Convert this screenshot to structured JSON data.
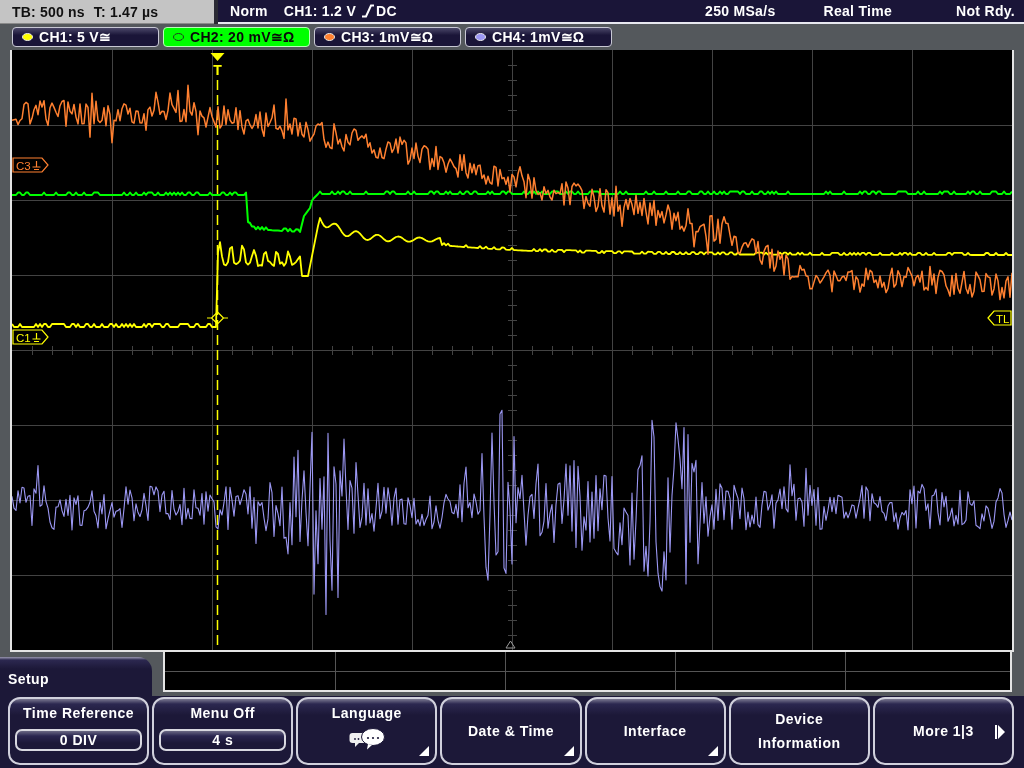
{
  "status_bar": {
    "timebase": "TB: 500 ns",
    "trigger_time": "T: 1.47 µs",
    "trigger_mode": "Norm",
    "trigger_source": "CH1: 1.2 V",
    "trigger_rising": true,
    "trigger_coupling": "DC",
    "sample_rate": "250 MSa/s",
    "acquisition": "Real Time",
    "status": "Not Rdy."
  },
  "channels": [
    {
      "label": "CH1: 5 V≅",
      "color": "#ffff00",
      "selected": false
    },
    {
      "label": "CH2: 20 mV≅Ω",
      "color": "#00ff00",
      "selected": true
    },
    {
      "label": "CH3: 1mV≅Ω",
      "color": "#ff8030",
      "selected": false
    },
    {
      "label": "CH4: 1mV≅Ω",
      "color": "#9c98f4",
      "selected": false
    }
  ],
  "display": {
    "trigger_marker": "T",
    "channel_markers": [
      {
        "label": "C3",
        "color": "#ff8030"
      },
      {
        "label": "C1",
        "color": "#ffff00"
      }
    ],
    "trigger_level_marker": "TL"
  },
  "menu": {
    "title": "Setup",
    "softkeys": [
      {
        "kind": "value",
        "label": "Time Reference",
        "value": "0 DIV",
        "submenu": false
      },
      {
        "kind": "value",
        "label": "Menu Off",
        "value": "4 s",
        "submenu": false
      },
      {
        "kind": "icon",
        "label": "Language",
        "submenu": true
      },
      {
        "kind": "plain",
        "label": "Date & Time",
        "submenu": true
      },
      {
        "kind": "plain",
        "label": "Interface",
        "submenu": true
      },
      {
        "kind": "plain",
        "label": "Device Information",
        "submenu": false
      },
      {
        "kind": "next",
        "label": "More 1|3",
        "submenu": false
      }
    ]
  }
}
